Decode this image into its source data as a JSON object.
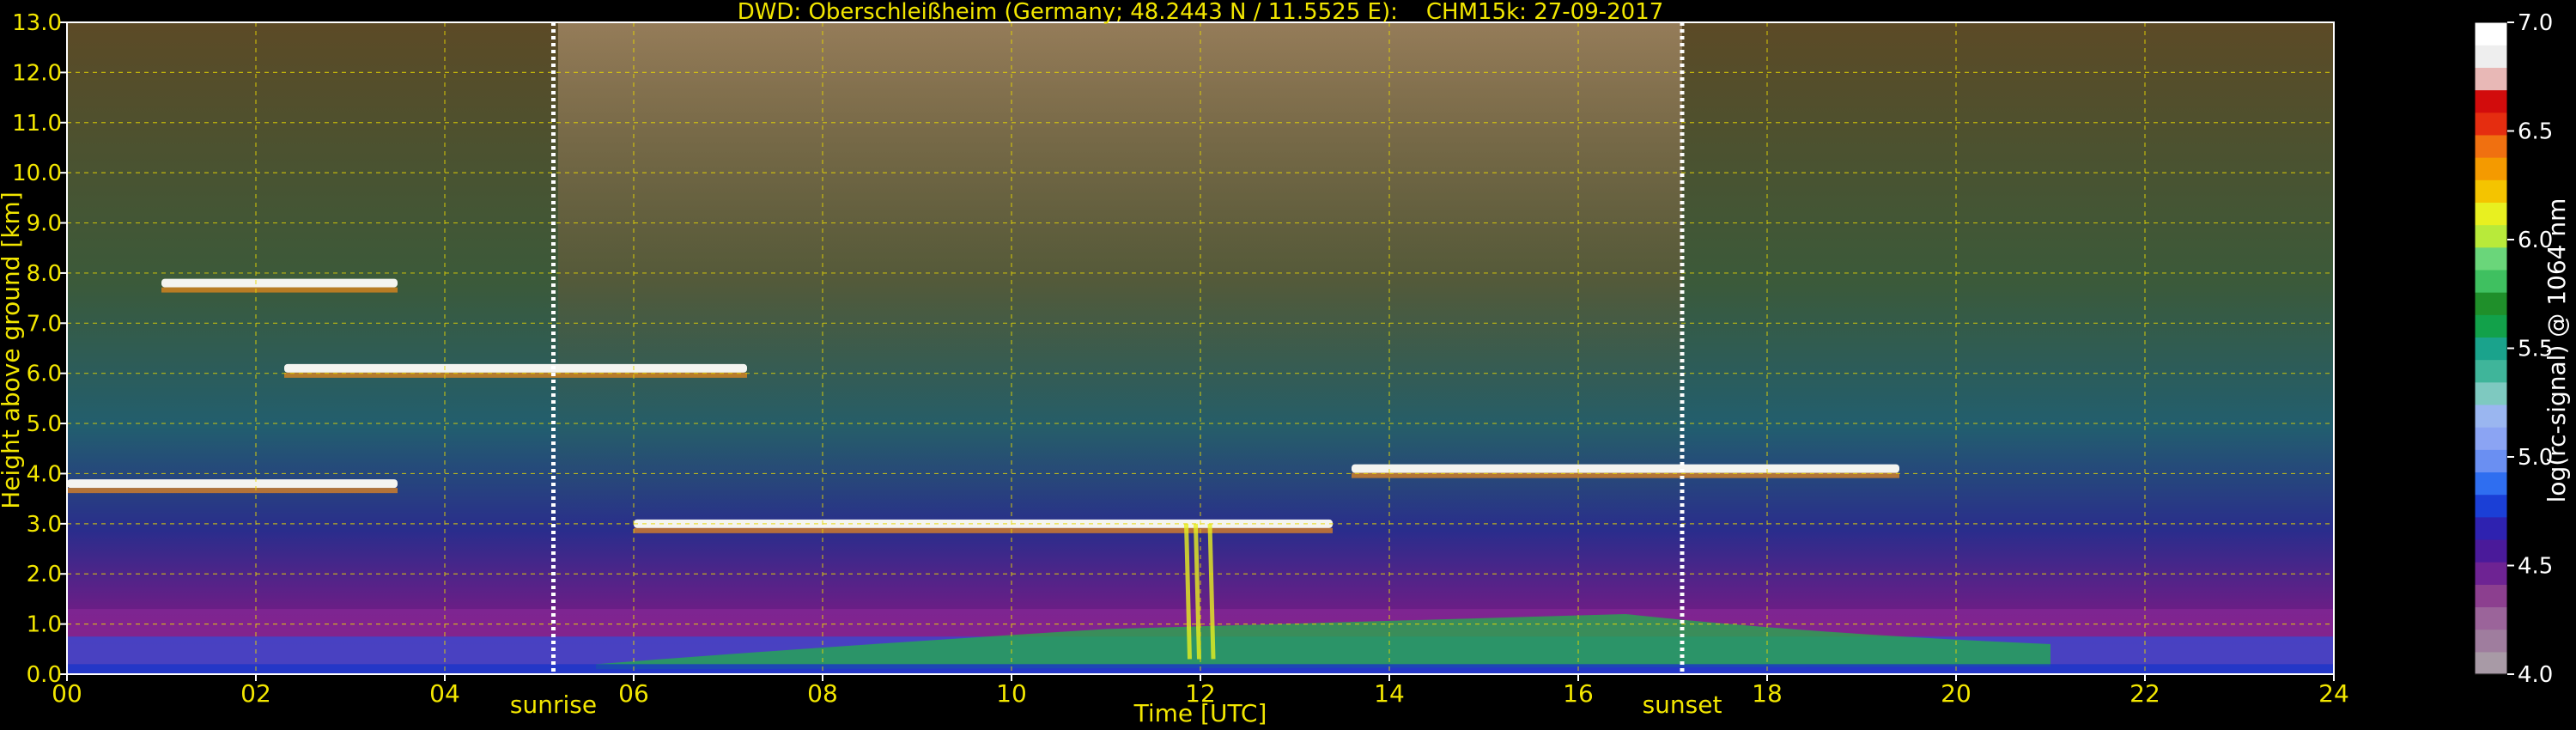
{
  "chart_data": {
    "type": "heatmap",
    "title": "DWD: Oberschleißheim (Germany; 48.2443 N / 11.5525 E):    CHM15k: 27-09-2017",
    "xlabel": "Time [UTC]",
    "ylabel": "Height above ground [km]",
    "xlim": [
      0,
      24
    ],
    "ylim": [
      0,
      13
    ],
    "x_ticks": [
      "00",
      "02",
      "04",
      "06",
      "08",
      "10",
      "12",
      "14",
      "16",
      "18",
      "20",
      "22",
      "24"
    ],
    "y_ticks": [
      "0.0",
      "1.0",
      "2.0",
      "3.0",
      "4.0",
      "5.0",
      "6.0",
      "7.0",
      "8.0",
      "9.0",
      "10.0",
      "11.0",
      "12.0",
      "13.0"
    ],
    "grid": true,
    "markers": [
      {
        "label": "sunrise",
        "x": 5.15
      },
      {
        "label": "sunset",
        "x": 17.1
      }
    ],
    "colorbar": {
      "label": "log(rc-signal) @ 1064 nm",
      "range": [
        4.0,
        7.0
      ],
      "ticks": [
        "4.0",
        "4.5",
        "5.0",
        "5.5",
        "6.0",
        "6.5",
        "7.0"
      ],
      "colors": [
        "#a89aa6",
        "#9f7d9e",
        "#9b649a",
        "#8c3f8f",
        "#6e2393",
        "#4a1a9a",
        "#2e22b0",
        "#1b3fd6",
        "#2f6ef0",
        "#6a8ff2",
        "#8ba4f3",
        "#9ab6f0",
        "#7ec9c0",
        "#3fb59a",
        "#1aa38c",
        "#12a14a",
        "#1f8f2a",
        "#3fc060",
        "#6ad67a",
        "#b8ea3a",
        "#e8f020",
        "#f4c400",
        "#f49a00",
        "#f07010",
        "#e52d10",
        "#d20c0c",
        "#e8b8b6",
        "#eeeeee",
        "#ffffff"
      ]
    },
    "layers": [
      {
        "name": "boundary layer",
        "x": [
          0,
          24
        ],
        "height_km": [
          0.05,
          1.3
        ]
      },
      {
        "name": "cloud layer 3.8 km",
        "x": [
          0,
          3.5
        ],
        "height_km": 3.8
      },
      {
        "name": "cloud layer 6.1 km",
        "x": [
          2.3,
          7.2
        ],
        "height_km": 6.1
      },
      {
        "name": "cloud layer 3.0 km",
        "x": [
          6.0,
          13.4
        ],
        "height_km": 3.0
      },
      {
        "name": "cloud layer 4.1 km",
        "x": [
          13.6,
          19.4
        ],
        "height_km": 4.1
      },
      {
        "name": "cirrus 7.8 km",
        "x": [
          1.0,
          3.5
        ],
        "height_km": 7.8
      }
    ]
  }
}
